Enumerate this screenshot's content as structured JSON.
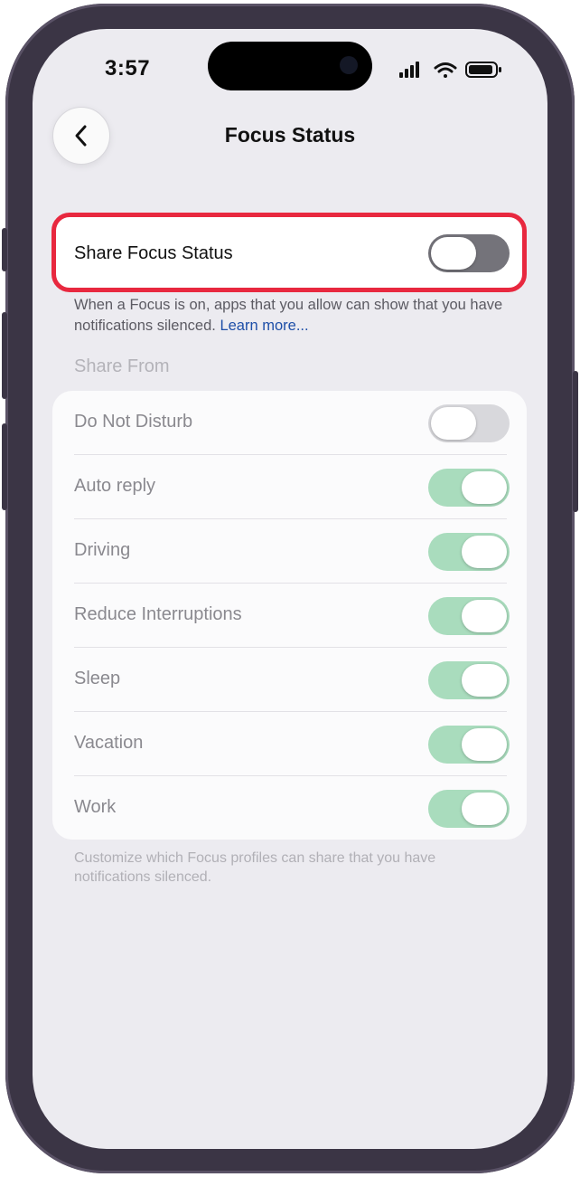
{
  "status_bar": {
    "time": "3:57"
  },
  "nav": {
    "title": "Focus Status"
  },
  "share_focus": {
    "label": "Share Focus Status",
    "enabled": false
  },
  "share_note": {
    "text": "When a Focus is on, apps that you allow can show that you have notifications silenced. ",
    "link": "Learn more..."
  },
  "share_from": {
    "header": "Share From",
    "items": [
      {
        "label": "Do Not Disturb",
        "enabled": false
      },
      {
        "label": "Auto reply",
        "enabled": true
      },
      {
        "label": "Driving",
        "enabled": true
      },
      {
        "label": "Reduce Interruptions",
        "enabled": true
      },
      {
        "label": "Sleep",
        "enabled": true
      },
      {
        "label": "Vacation",
        "enabled": true
      },
      {
        "label": "Work",
        "enabled": true
      }
    ]
  },
  "footer": {
    "text": "Customize which Focus profiles can share that you have notifications silenced."
  },
  "colors": {
    "highlight": "#e8283f",
    "toggle_on_dimmed": "#a9dcbd",
    "link": "#1e4fa8"
  }
}
